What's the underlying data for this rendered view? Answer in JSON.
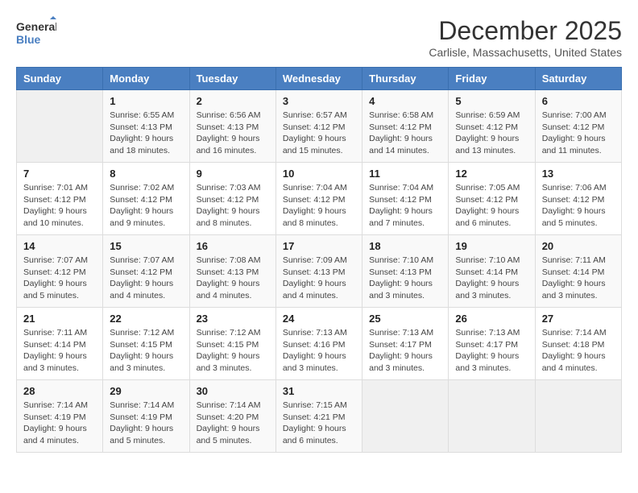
{
  "logo": {
    "line1": "General",
    "line2": "Blue"
  },
  "title": "December 2025",
  "location": "Carlisle, Massachusetts, United States",
  "weekdays": [
    "Sunday",
    "Monday",
    "Tuesday",
    "Wednesday",
    "Thursday",
    "Friday",
    "Saturday"
  ],
  "weeks": [
    [
      {
        "day": "",
        "empty": true
      },
      {
        "day": "1",
        "sunrise": "6:55 AM",
        "sunset": "4:13 PM",
        "daylight": "9 hours and 18 minutes."
      },
      {
        "day": "2",
        "sunrise": "6:56 AM",
        "sunset": "4:13 PM",
        "daylight": "9 hours and 16 minutes."
      },
      {
        "day": "3",
        "sunrise": "6:57 AM",
        "sunset": "4:12 PM",
        "daylight": "9 hours and 15 minutes."
      },
      {
        "day": "4",
        "sunrise": "6:58 AM",
        "sunset": "4:12 PM",
        "daylight": "9 hours and 14 minutes."
      },
      {
        "day": "5",
        "sunrise": "6:59 AM",
        "sunset": "4:12 PM",
        "daylight": "9 hours and 13 minutes."
      },
      {
        "day": "6",
        "sunrise": "7:00 AM",
        "sunset": "4:12 PM",
        "daylight": "9 hours and 11 minutes."
      }
    ],
    [
      {
        "day": "7",
        "sunrise": "7:01 AM",
        "sunset": "4:12 PM",
        "daylight": "9 hours and 10 minutes."
      },
      {
        "day": "8",
        "sunrise": "7:02 AM",
        "sunset": "4:12 PM",
        "daylight": "9 hours and 9 minutes."
      },
      {
        "day": "9",
        "sunrise": "7:03 AM",
        "sunset": "4:12 PM",
        "daylight": "9 hours and 8 minutes."
      },
      {
        "day": "10",
        "sunrise": "7:04 AM",
        "sunset": "4:12 PM",
        "daylight": "9 hours and 8 minutes."
      },
      {
        "day": "11",
        "sunrise": "7:04 AM",
        "sunset": "4:12 PM",
        "daylight": "9 hours and 7 minutes."
      },
      {
        "day": "12",
        "sunrise": "7:05 AM",
        "sunset": "4:12 PM",
        "daylight": "9 hours and 6 minutes."
      },
      {
        "day": "13",
        "sunrise": "7:06 AM",
        "sunset": "4:12 PM",
        "daylight": "9 hours and 5 minutes."
      }
    ],
    [
      {
        "day": "14",
        "sunrise": "7:07 AM",
        "sunset": "4:12 PM",
        "daylight": "9 hours and 5 minutes."
      },
      {
        "day": "15",
        "sunrise": "7:07 AM",
        "sunset": "4:12 PM",
        "daylight": "9 hours and 4 minutes."
      },
      {
        "day": "16",
        "sunrise": "7:08 AM",
        "sunset": "4:13 PM",
        "daylight": "9 hours and 4 minutes."
      },
      {
        "day": "17",
        "sunrise": "7:09 AM",
        "sunset": "4:13 PM",
        "daylight": "9 hours and 4 minutes."
      },
      {
        "day": "18",
        "sunrise": "7:10 AM",
        "sunset": "4:13 PM",
        "daylight": "9 hours and 3 minutes."
      },
      {
        "day": "19",
        "sunrise": "7:10 AM",
        "sunset": "4:14 PM",
        "daylight": "9 hours and 3 minutes."
      },
      {
        "day": "20",
        "sunrise": "7:11 AM",
        "sunset": "4:14 PM",
        "daylight": "9 hours and 3 minutes."
      }
    ],
    [
      {
        "day": "21",
        "sunrise": "7:11 AM",
        "sunset": "4:14 PM",
        "daylight": "9 hours and 3 minutes."
      },
      {
        "day": "22",
        "sunrise": "7:12 AM",
        "sunset": "4:15 PM",
        "daylight": "9 hours and 3 minutes."
      },
      {
        "day": "23",
        "sunrise": "7:12 AM",
        "sunset": "4:15 PM",
        "daylight": "9 hours and 3 minutes."
      },
      {
        "day": "24",
        "sunrise": "7:13 AM",
        "sunset": "4:16 PM",
        "daylight": "9 hours and 3 minutes."
      },
      {
        "day": "25",
        "sunrise": "7:13 AM",
        "sunset": "4:17 PM",
        "daylight": "9 hours and 3 minutes."
      },
      {
        "day": "26",
        "sunrise": "7:13 AM",
        "sunset": "4:17 PM",
        "daylight": "9 hours and 3 minutes."
      },
      {
        "day": "27",
        "sunrise": "7:14 AM",
        "sunset": "4:18 PM",
        "daylight": "9 hours and 4 minutes."
      }
    ],
    [
      {
        "day": "28",
        "sunrise": "7:14 AM",
        "sunset": "4:19 PM",
        "daylight": "9 hours and 4 minutes."
      },
      {
        "day": "29",
        "sunrise": "7:14 AM",
        "sunset": "4:19 PM",
        "daylight": "9 hours and 5 minutes."
      },
      {
        "day": "30",
        "sunrise": "7:14 AM",
        "sunset": "4:20 PM",
        "daylight": "9 hours and 5 minutes."
      },
      {
        "day": "31",
        "sunrise": "7:15 AM",
        "sunset": "4:21 PM",
        "daylight": "9 hours and 6 minutes."
      },
      {
        "day": "",
        "empty": true
      },
      {
        "day": "",
        "empty": true
      },
      {
        "day": "",
        "empty": true
      }
    ]
  ]
}
